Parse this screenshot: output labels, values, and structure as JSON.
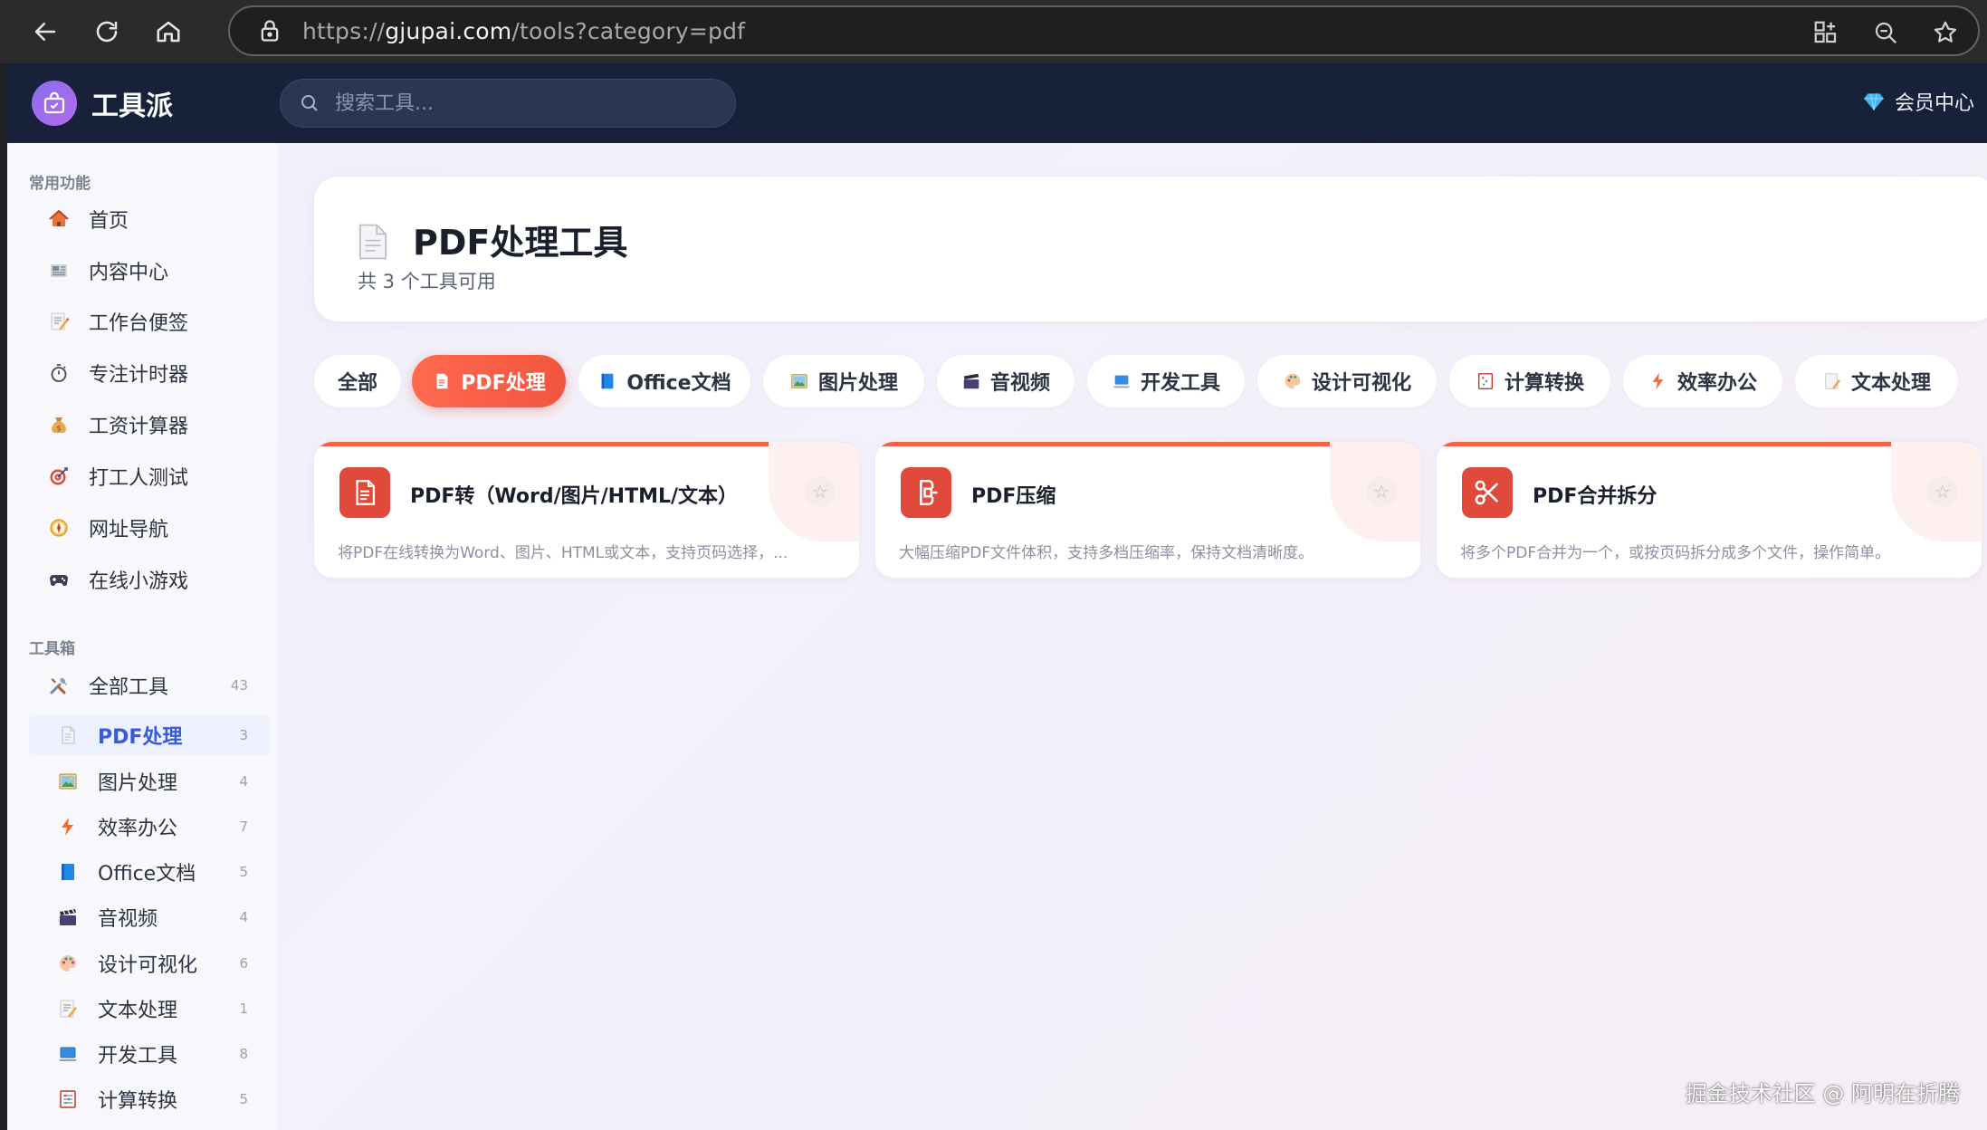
{
  "browser": {
    "url_prefix": "https://",
    "url_host": "gjupai.com",
    "url_path": "/tools?category=pdf"
  },
  "app": {
    "name": "工具派",
    "search_placeholder": "搜索工具...",
    "member_label": "会员中心"
  },
  "sidebar": {
    "common_title": "常用功能",
    "common_items": [
      {
        "label": "首页",
        "icon": "house-icon"
      },
      {
        "label": "内容中心",
        "icon": "newspaper-icon"
      },
      {
        "label": "工作台便签",
        "icon": "memo-icon"
      },
      {
        "label": "专注计时器",
        "icon": "stopwatch-icon"
      },
      {
        "label": "工资计算器",
        "icon": "money-bag-icon"
      },
      {
        "label": "打工人测试",
        "icon": "target-icon"
      },
      {
        "label": "网址导航",
        "icon": "compass-icon"
      },
      {
        "label": "在线小游戏",
        "icon": "gamepad-icon"
      }
    ],
    "toolbox_title": "工具箱",
    "all_tools": {
      "label": "全部工具",
      "count": "43"
    },
    "categories": [
      {
        "label": "PDF处理",
        "count": "3",
        "active": true
      },
      {
        "label": "图片处理",
        "count": "4"
      },
      {
        "label": "效率办公",
        "count": "7"
      },
      {
        "label": "Office文档",
        "count": "5"
      },
      {
        "label": "音视频",
        "count": "4"
      },
      {
        "label": "设计可视化",
        "count": "6"
      },
      {
        "label": "文本处理",
        "count": "1"
      },
      {
        "label": "开发工具",
        "count": "8"
      },
      {
        "label": "计算转换",
        "count": "5"
      }
    ]
  },
  "header": {
    "title": "PDF处理工具",
    "subtitle": "共 3 个工具可用"
  },
  "filters": [
    {
      "label": "全部"
    },
    {
      "label": "PDF处理",
      "active": true
    },
    {
      "label": "Office文档"
    },
    {
      "label": "图片处理"
    },
    {
      "label": "音视频"
    },
    {
      "label": "开发工具"
    },
    {
      "label": "设计可视化"
    },
    {
      "label": "计算转换"
    },
    {
      "label": "效率办公"
    },
    {
      "label": "文本处理"
    }
  ],
  "tools": [
    {
      "title": "PDF转（Word/图片/HTML/文本）",
      "desc": "将PDF在线转换为Word、图片、HTML或文本，支持页码选择，...",
      "icon": "document-icon"
    },
    {
      "title": "PDF压缩",
      "desc": "大幅压缩PDF文件体积，支持多档压缩率，保持文档清晰度。",
      "icon": "clamp-icon"
    },
    {
      "title": "PDF合并拆分",
      "desc": "将多个PDF合并为一个，或按页码拆分成多个文件，操作简单。",
      "icon": "scissors-icon"
    }
  ],
  "star_glyph": "☆",
  "watermark": "掘金技术社区 @ 阿明在折腾",
  "colors": {
    "accent": "#f2553f",
    "nav": "#17213a",
    "active_blue": "#3a5bd9"
  }
}
